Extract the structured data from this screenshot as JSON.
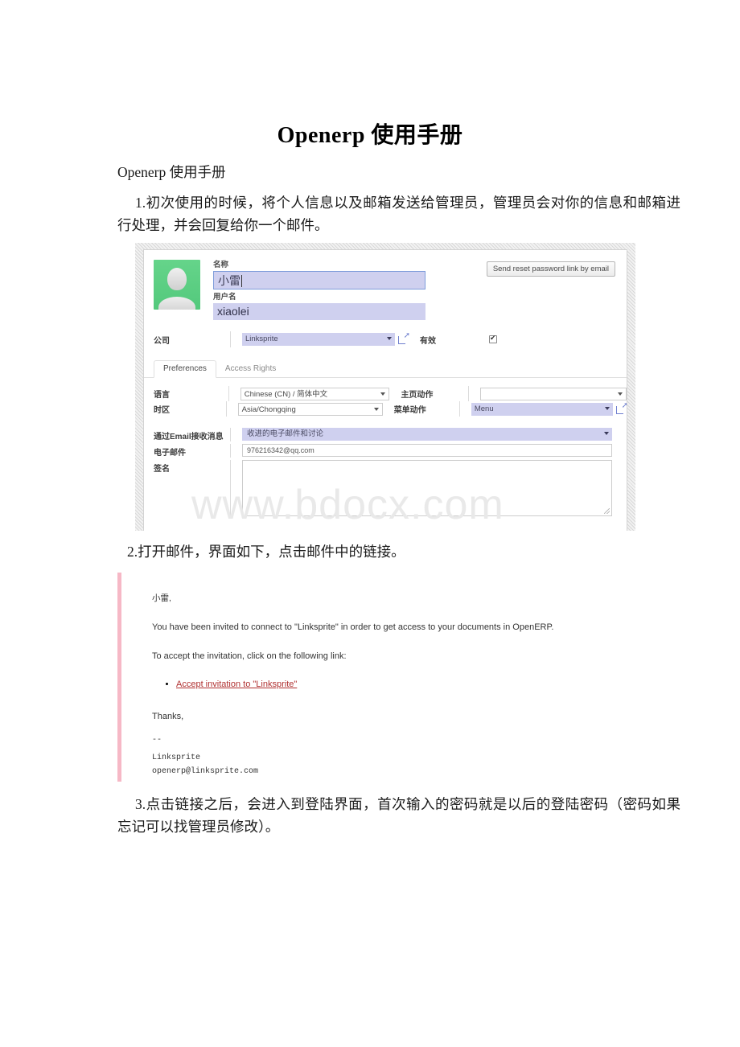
{
  "document": {
    "title": "Openerp 使用手册",
    "subtitle": "Openerp 使用手册",
    "step1": "1.初次使用的时候，将个人信息以及邮箱发送给管理员，管理员会对你的信息和邮箱进行处理，并会回复给你一个邮件。",
    "step2": "2.打开邮件，界面如下，点击邮件中的链接。",
    "step3": "3.点击链接之后，会进入到登陆界面，首次输入的密码就是以后的登陆密码（密码如果忘记可以找管理员修改）。",
    "watermark": "www.bdocx.com"
  },
  "erp_form": {
    "name_label": "名称",
    "name_value": "小雷",
    "login_label": "用户名",
    "login_value": "xiaolei",
    "reset_button": "Send reset password link by email",
    "company_label": "公司",
    "company_value": "Linksprite",
    "active_label": "有效",
    "tabs": [
      {
        "label": "Preferences",
        "active": true
      },
      {
        "label": "Access Rights",
        "active": false
      }
    ],
    "language_label": "语言",
    "language_value": "Chinese (CN) / 简体中文",
    "timezone_label": "时区",
    "timezone_value": "Asia/Chongqing",
    "home_action_label": "主页动作",
    "home_action_value": "",
    "menu_action_label": "菜单动作",
    "menu_action_value": "Menu",
    "email_pref_label": "通过Email接收消息",
    "email_pref_value": "收进的电子邮件和讨论",
    "email_label": "电子邮件",
    "email_value": "976216342@qq.com",
    "signature_label": "签名",
    "signature_value": ""
  },
  "email": {
    "greeting": "小雷,",
    "line1": "You have been invited to connect to \"Linksprite\" in order to get access to your documents in OpenERP.",
    "line2": "To accept the invitation, click on the following link:",
    "link": "Accept invitation to \"Linksprite\"",
    "thanks": "Thanks,",
    "dash": "--",
    "signature_company": "Linksprite",
    "signature_email": "openerp@linksprite.com"
  },
  "colors": {
    "accent_field": "#cfd0ef",
    "avatar_green": "#53c97c",
    "email_border": "#f6b8c6",
    "link_red": "#b03030"
  }
}
